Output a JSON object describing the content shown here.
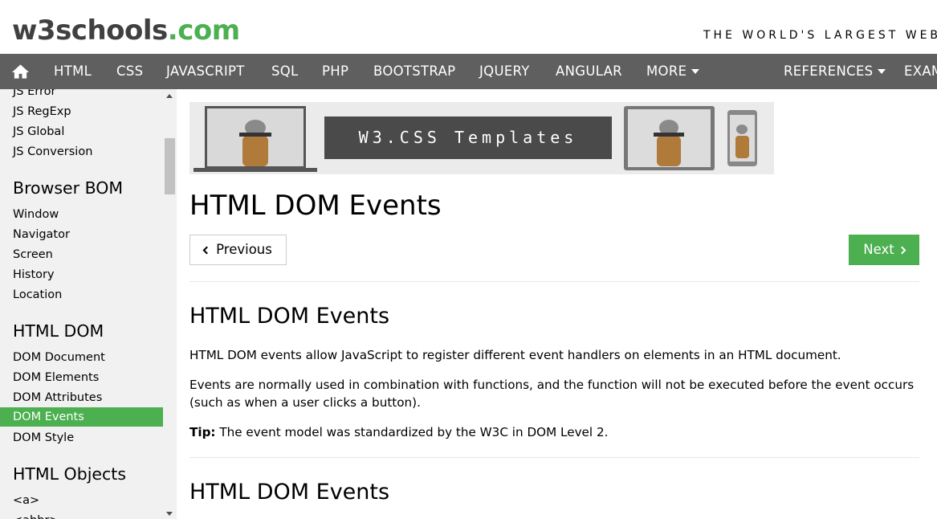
{
  "header": {
    "logo_part1": "w3schools",
    "logo_part2": ".com",
    "tagline": "THE WORLD'S LARGEST WEB"
  },
  "nav": {
    "home_icon": "home-icon",
    "items": [
      "HTML",
      "CSS",
      "JAVASCRIPT",
      "SQL",
      "PHP",
      "BOOTSTRAP",
      "JQUERY",
      "ANGULAR",
      "MORE",
      "REFERENCES",
      "EXAM"
    ]
  },
  "sidebar": {
    "js_links": [
      "JS Error",
      "JS RegExp",
      "JS Global",
      "JS Conversion"
    ],
    "browser_bom": {
      "heading": "Browser BOM",
      "links": [
        "Window",
        "Navigator",
        "Screen",
        "History",
        "Location"
      ]
    },
    "html_dom": {
      "heading": "HTML DOM",
      "links": [
        "DOM Document",
        "DOM Elements",
        "DOM Attributes",
        "DOM Events",
        "DOM Style"
      ]
    },
    "html_objects": {
      "heading": "HTML Objects",
      "links": [
        "<a>",
        "<abbr>"
      ]
    }
  },
  "banner": {
    "text": "W3.CSS Templates"
  },
  "main": {
    "title": "HTML DOM Events",
    "prev_label": "Previous",
    "next_label": "Next",
    "section1": {
      "heading": "HTML DOM Events",
      "p1": "HTML DOM events allow JavaScript to register different event handlers on elements in an HTML document.",
      "p2": "Events are normally used in combination with functions, and the function will not be executed before the event occurs (such as when a user clicks a button).",
      "tip_label": "Tip:",
      "tip_text": " The event model was standardized by the W3C in DOM Level 2."
    },
    "section2": {
      "heading": "HTML DOM Events"
    }
  },
  "colors": {
    "accent": "#4CAF50",
    "nav_bg": "#5f5f5f",
    "sidebar_bg": "#f1f1f1"
  }
}
